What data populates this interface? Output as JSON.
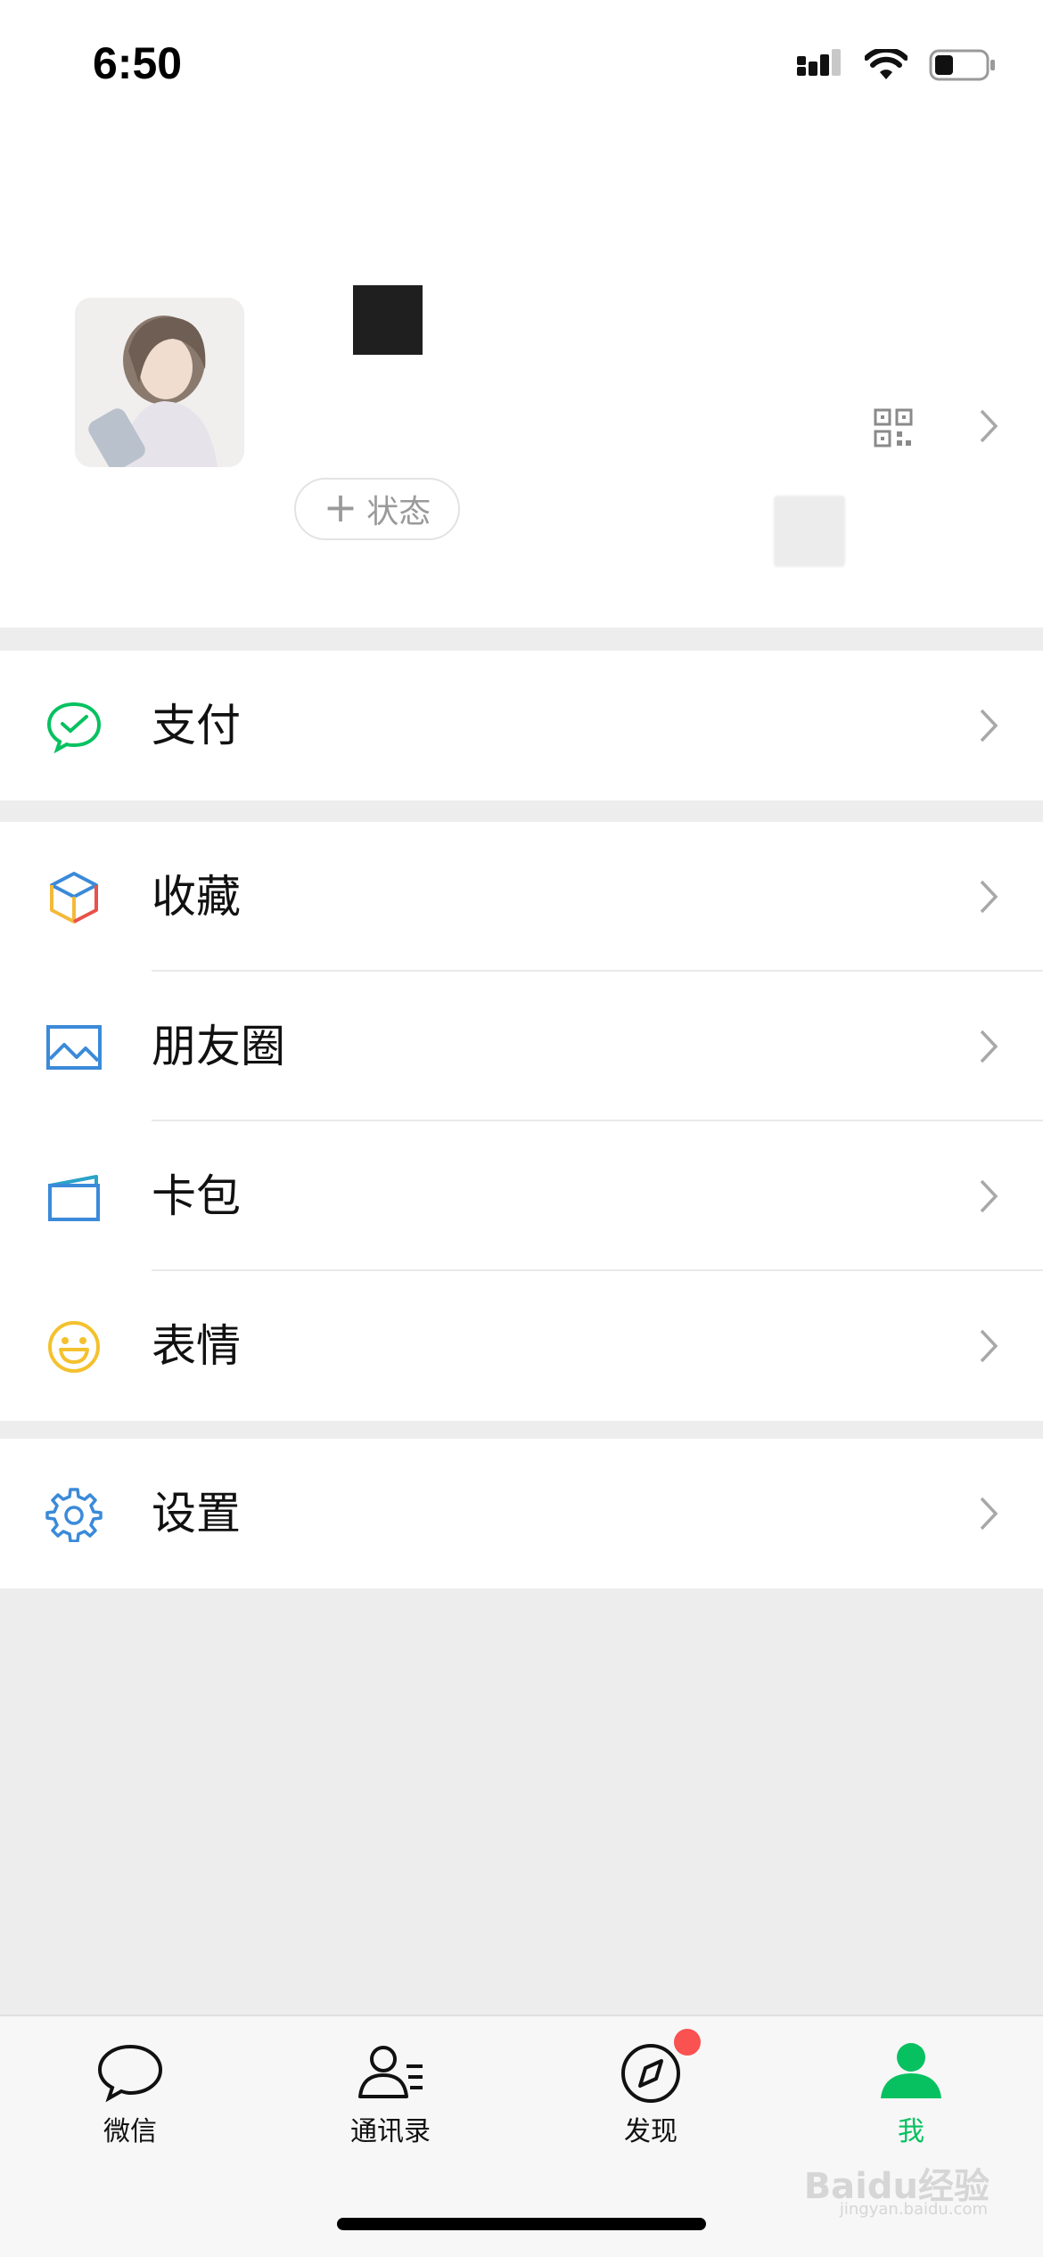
{
  "status_bar": {
    "time": "6:50"
  },
  "profile": {
    "status_button_label": "状态"
  },
  "groups": [
    {
      "items": [
        {
          "label": "支付",
          "icon": "pay-icon"
        }
      ]
    },
    {
      "items": [
        {
          "label": "收藏",
          "icon": "favorites-icon"
        },
        {
          "label": "朋友圈",
          "icon": "moments-icon"
        },
        {
          "label": "卡包",
          "icon": "card-wallet-icon"
        },
        {
          "label": "表情",
          "icon": "sticker-icon"
        }
      ]
    },
    {
      "items": [
        {
          "label": "设置",
          "icon": "settings-icon"
        }
      ]
    }
  ],
  "tabbar": {
    "tabs": [
      {
        "label": "微信",
        "icon": "chat-icon"
      },
      {
        "label": "通讯录",
        "icon": "contacts-icon"
      },
      {
        "label": "发现",
        "icon": "discover-icon",
        "badge": true
      },
      {
        "label": "我",
        "icon": "me-icon",
        "active": true
      }
    ]
  },
  "watermark": {
    "text": "Baidu经验",
    "sub": "jingyan.baidu.com"
  },
  "colors": {
    "accent": "#07c160",
    "badge": "#fa5151",
    "divider_bg": "#ededed"
  }
}
